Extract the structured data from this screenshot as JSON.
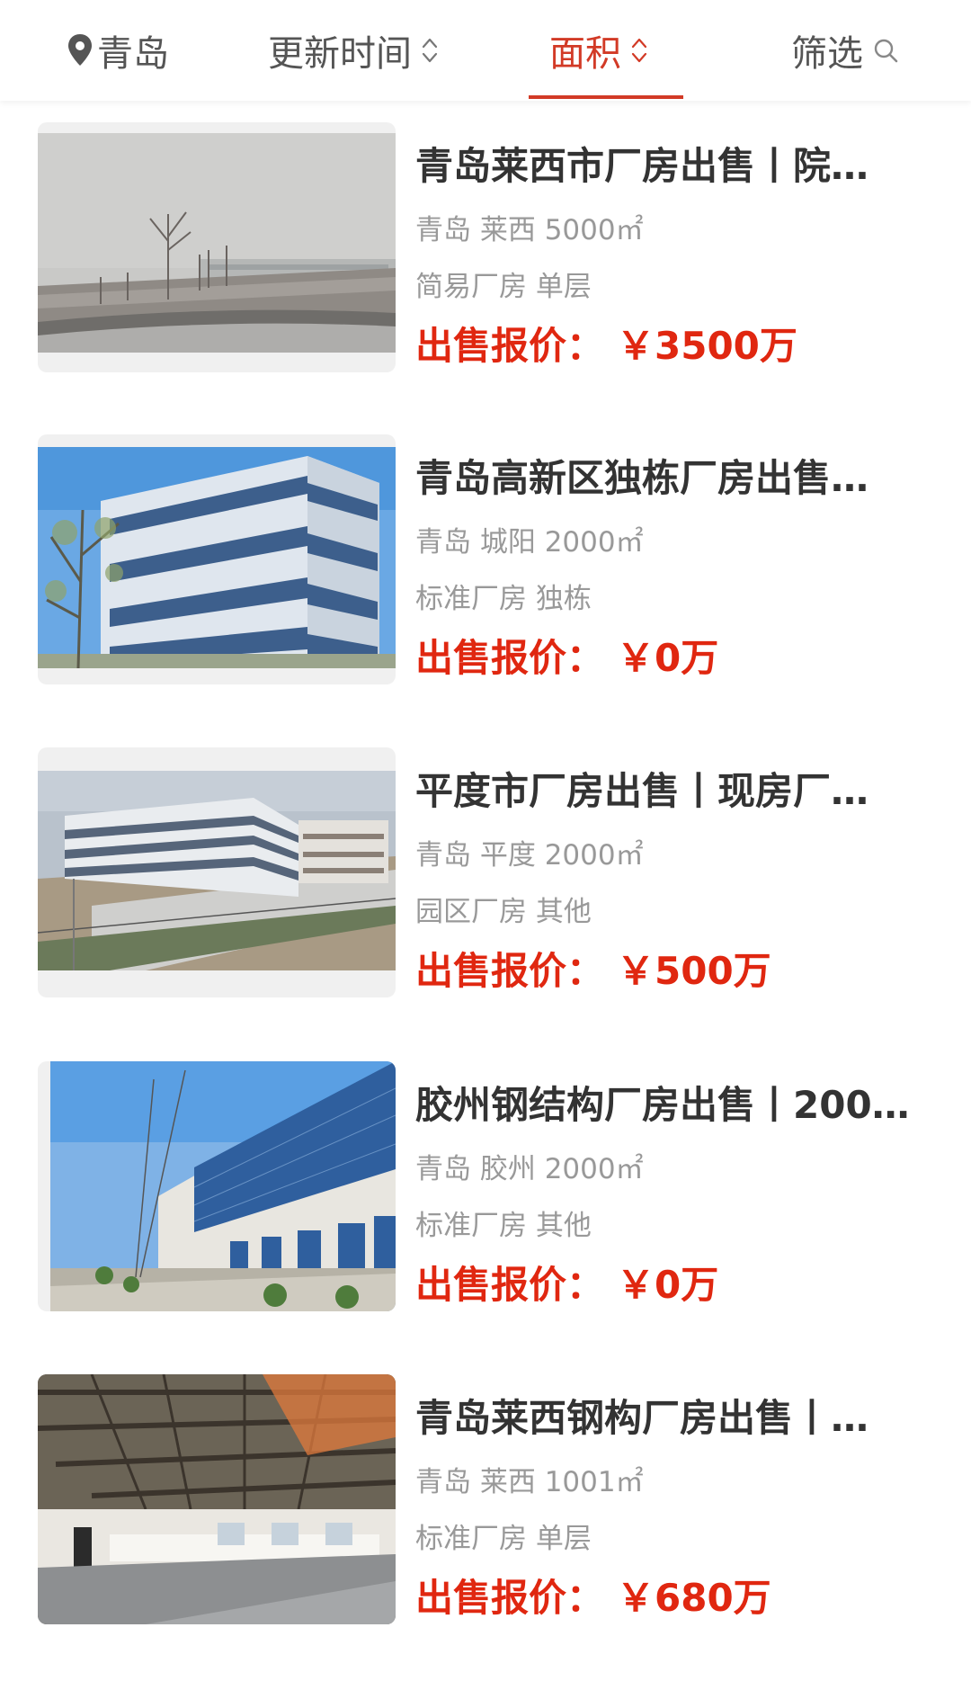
{
  "filter_bar": {
    "location": "青岛",
    "updated": "更新时间",
    "area": "面积",
    "filter": "筛选"
  },
  "colors": {
    "accent": "#d23a26",
    "price": "#e02710",
    "title": "#333333",
    "meta": "#999999"
  },
  "price_label": "出售报价：",
  "listings": [
    {
      "title": "青岛莱西市厂房出售丨院…",
      "location": "青岛 莱西 5000㎡",
      "type": "简易厂房 单层",
      "price": "￥3500万",
      "image": "snowy-field-photo"
    },
    {
      "title": "青岛高新区独栋厂房出售…",
      "location": "青岛 城阳 2000㎡",
      "type": "标准厂房 独栋",
      "price": "￥0万",
      "image": "glass-office-building-photo"
    },
    {
      "title": "平度市厂房出售丨现房厂…",
      "location": "青岛 平度 2000㎡",
      "type": "园区厂房 其他",
      "price": "￥500万",
      "image": "industrial-park-aerial-photo"
    },
    {
      "title": "胶州钢结构厂房出售丨200…",
      "location": "青岛 胶州 2000㎡",
      "type": "标准厂房 其他",
      "price": "￥0万",
      "image": "blue-glass-factory-photo"
    },
    {
      "title": "青岛莱西钢构厂房出售丨…",
      "location": "青岛 莱西 1001㎡",
      "type": "标准厂房 单层",
      "price": "￥680万",
      "image": "steel-warehouse-interior-photo"
    }
  ]
}
